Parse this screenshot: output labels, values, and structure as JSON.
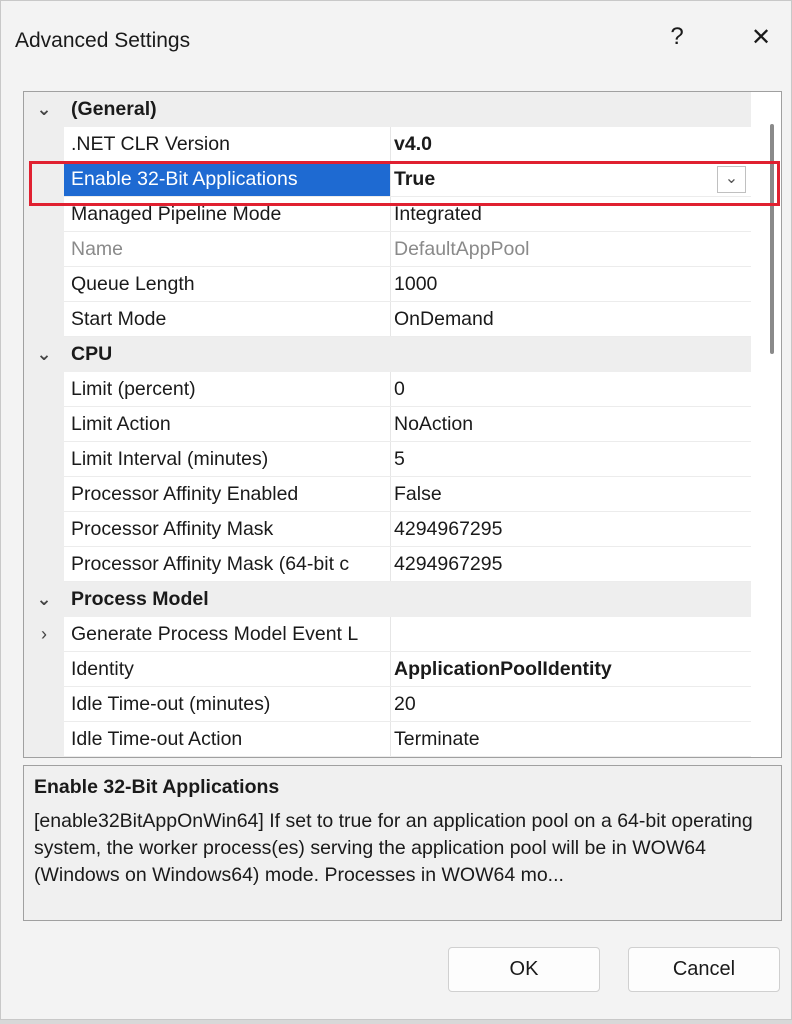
{
  "window": {
    "title": "Advanced Settings",
    "help_glyph": "?",
    "close_glyph": "✕"
  },
  "grid": {
    "rows": [
      {
        "kind": "category",
        "name": "(General)",
        "toggle": "⌄"
      },
      {
        "kind": "property",
        "name": ".NET CLR Version",
        "value": "v4.0",
        "bold": true
      },
      {
        "kind": "property",
        "name": "Enable 32-Bit Applications",
        "value": "True",
        "bold": true,
        "selected": true,
        "dropdown": "⌄"
      },
      {
        "kind": "property",
        "name": "Managed Pipeline Mode",
        "value": "Integrated"
      },
      {
        "kind": "property",
        "name": "Name",
        "value": "DefaultAppPool",
        "disabled": true
      },
      {
        "kind": "property",
        "name": "Queue Length",
        "value": "1000"
      },
      {
        "kind": "property",
        "name": "Start Mode",
        "value": "OnDemand"
      },
      {
        "kind": "category",
        "name": "CPU",
        "toggle": "⌄"
      },
      {
        "kind": "property",
        "name": "Limit (percent)",
        "value": "0"
      },
      {
        "kind": "property",
        "name": "Limit Action",
        "value": "NoAction"
      },
      {
        "kind": "property",
        "name": "Limit Interval (minutes)",
        "value": "5"
      },
      {
        "kind": "property",
        "name": "Processor Affinity Enabled",
        "value": "False"
      },
      {
        "kind": "property",
        "name": "Processor Affinity Mask",
        "value": "4294967295"
      },
      {
        "kind": "property",
        "name": "Processor Affinity Mask (64-bit c",
        "value": "4294967295"
      },
      {
        "kind": "category",
        "name": "Process Model",
        "toggle": "⌄"
      },
      {
        "kind": "property",
        "name": "Generate Process Model Event L",
        "value": "",
        "toggle": "›"
      },
      {
        "kind": "property",
        "name": "Identity",
        "value": "ApplicationPoolIdentity",
        "bold": true
      },
      {
        "kind": "property",
        "name": "Idle Time-out (minutes)",
        "value": "20"
      },
      {
        "kind": "property",
        "name": "Idle Time-out Action",
        "value": "Terminate"
      }
    ]
  },
  "description": {
    "title": "Enable 32-Bit Applications",
    "text": "[enable32BitAppOnWin64] If set to true for an application pool on a 64-bit operating system, the worker process(es) serving the application pool will be in WOW64 (Windows on Windows64) mode. Processes in WOW64 mo..."
  },
  "buttons": {
    "ok": "OK",
    "cancel": "Cancel"
  },
  "colors": {
    "selection": "#1e6ad2",
    "highlight_box": "#e02030"
  }
}
